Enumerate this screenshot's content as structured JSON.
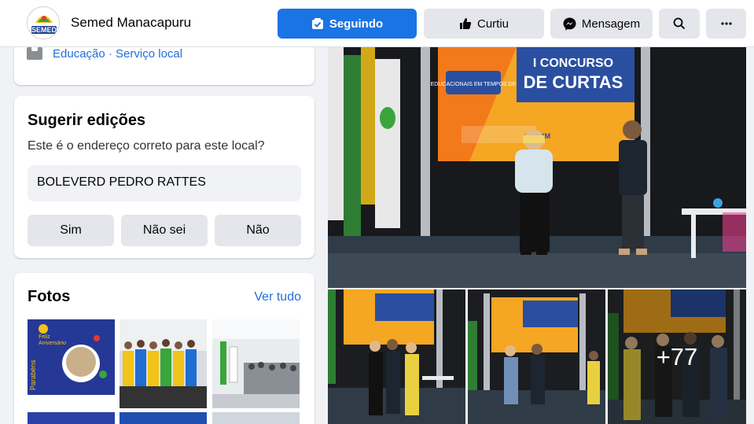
{
  "header": {
    "page_name": "Semed Manacapuru",
    "logo_text": "SEMED",
    "buttons": {
      "following": "Seguindo",
      "liked": "Curtiu",
      "message": "Mensagem"
    }
  },
  "info": {
    "category": "Educação · Serviço local"
  },
  "suggest": {
    "title": "Sugerir edições",
    "question": "Este é o endereço correto para este local?",
    "address": "BOLEVERD PEDRO RATTES",
    "answers": [
      "Sim",
      "Não sei",
      "Não"
    ]
  },
  "photos_section": {
    "title": "Fotos",
    "see_all": "Ver tudo",
    "thumb1_lines": [
      "Feliz",
      "Aniversário",
      "Parabéns"
    ]
  },
  "gallery": {
    "banner_top": "I CONCURSO",
    "banner_bottom": "DE CURTAS",
    "banner_left": "EDUCACIONAIS EM TEMPOS DE",
    "stage_brand": "SECOM",
    "more_count": "+77"
  },
  "colors": {
    "accent": "#1b74e4",
    "link": "#216fdb",
    "button_bg": "#e4e6eb",
    "page_bg": "#f0f2f5"
  }
}
